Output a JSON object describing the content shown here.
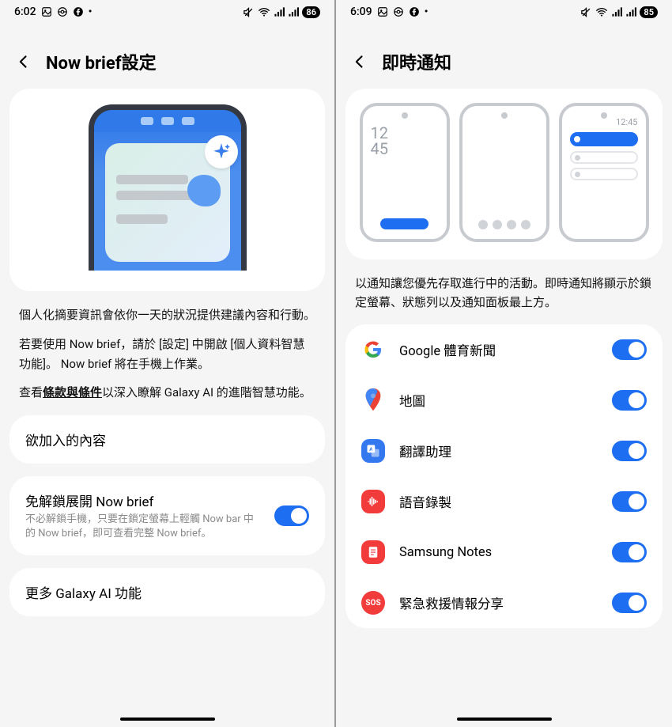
{
  "left": {
    "status": {
      "time": "6:02",
      "battery": "86"
    },
    "title": "Now brief設定",
    "desc1": "個人化摘要資訊會依你一天的狀況提供建議內容和行動。",
    "desc2a": "若要使用 Now brief，請於 [設定] 中開啟 [個人資料智慧功能]。 Now brief 將在手機上作業。",
    "desc3_pre": "查看",
    "desc3_link": "條款與條件",
    "desc3_post": "以深入瞭解 Galaxy AI 的進階智慧功能。",
    "section_content_title": "欲加入的內容",
    "unlock": {
      "title": "免解鎖展開 Now brief",
      "sub": "不必解鎖手機，只要在鎖定螢幕上輕觸 Now bar 中的 Now brief，即可查看完整 Now brief。"
    },
    "more": "更多 Galaxy AI 功能"
  },
  "right": {
    "status": {
      "time": "6:09",
      "battery": "85"
    },
    "title": "即時通知",
    "illus_clock": "12\n45",
    "illus_time": "12:45",
    "desc": "以通知讓您優先存取進行中的活動。即時通知將顯示於鎖定螢幕、狀態列以及通知面板最上方。",
    "apps": [
      {
        "name": "Google 體育新聞"
      },
      {
        "name": "地圖"
      },
      {
        "name": "翻譯助理"
      },
      {
        "name": "語音錄製"
      },
      {
        "name": "Samsung Notes"
      },
      {
        "name": "緊急救援情報分享"
      }
    ]
  }
}
